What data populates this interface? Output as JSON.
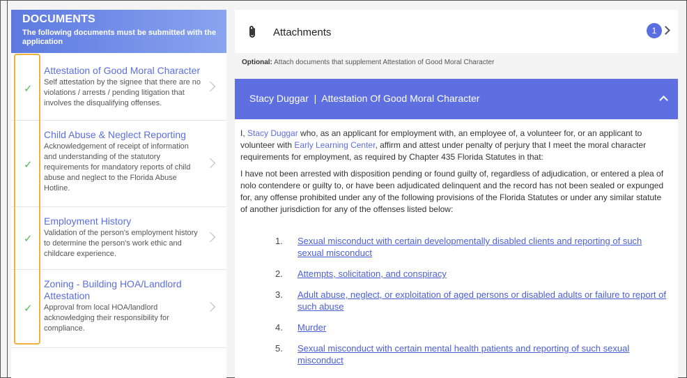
{
  "sidebar": {
    "heading": "DOCUMENTS",
    "subheading": "The following documents must be submitted with the application",
    "items": [
      {
        "title": "Attestation of Good Moral Character",
        "description": "Self attestation by the signee that there are no violations / arrests / pending litigation that involves the disqualifying offenses.",
        "check": "✓"
      },
      {
        "title": "Child Abuse & Neglect Reporting",
        "description": "Acknowledgement of receipt of information and understanding of the statutory requirements for mandatory reports of child abuse and neglect to the Florida Abuse Hotline.",
        "check": "✓"
      },
      {
        "title": "Employment History",
        "description": "Validation of the person's employment history to determine the person's work ethic and childcare experience.",
        "check": "✓"
      },
      {
        "title": "Zoning - Building HOA/Landlord Attestation",
        "description": "Approval from local HOA/landlord acknowledging their responsibility for compliance.",
        "check": "✓"
      }
    ]
  },
  "attachments": {
    "icon": "paperclip-icon",
    "title": "Attachments",
    "count": "1"
  },
  "optional": {
    "label": "Optional:",
    "text": " Attach documents that supplement Attestation of Good Moral Character"
  },
  "card": {
    "title": "Stacy Duggar  |  Attestation Of Good Moral Character",
    "para1": {
      "t1": "I, ",
      "name": "Stacy Duggar",
      "t2": " who, as an applicant for employment with, an employee of, a volunteer for, or an applicant to volunteer with ",
      "org": "Early Learning Center",
      "t3": ", affirm and attest under penalty of perjury that I meet the moral character requirements for employment, as required by Chapter 435 Florida Statutes in that:"
    },
    "para2": "I have not been arrested with disposition pending or found guilty of, regardless of adjudication, or entered a plea of nolo contendere or guilty to, or have been adjudicated delinquent and the record has not been sealed or expunged for, any offense prohibited under any of the following provisions of the Florida Statutes or under any similar statute of another jurisdiction for any of the offenses listed below:",
    "offenses": [
      {
        "num": "1.",
        "text": "Sexual misconduct with certain developmentally disabled clients and reporting of such sexual misconduct"
      },
      {
        "num": "2.",
        "text": "Attempts, solicitation, and conspiracy"
      },
      {
        "num": "3.",
        "text": "Adult abuse, neglect, or exploitation of aged persons or disabled adults or failure to report of such abuse"
      },
      {
        "num": "4.",
        "text": "Murder"
      },
      {
        "num": "5.",
        "text": "Sexual misconduct with certain mental health patients and reporting of such sexual misconduct"
      }
    ]
  },
  "colors": {
    "accent": "#5e70df",
    "check": "#55b855",
    "highlight": "#f0b03a"
  }
}
